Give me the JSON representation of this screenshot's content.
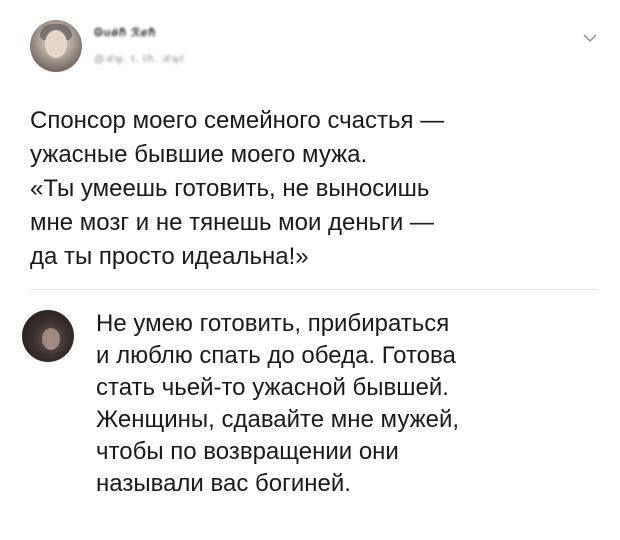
{
  "tweet": {
    "author_name": "Ꙩuǿℏ ℛℯℏ",
    "author_handle": "@ℛꝡ. ℓ. ℓℏ. ℛꝡℓ",
    "text": "Спонсор моего семейного счастья —\nужасные бывшие моего мужа.\n«Ты умеешь готовить, не выносишь\nмне мозг и не тянешь мои деньги —\nда ты просто идеальна!»",
    "menu_icon": "chevron-down-icon"
  },
  "reply": {
    "text": "Не умею готовить, прибираться\nи люблю спать до обеда. Готова\nстать чьей-то ужасной бывшей.\nЖенщины, сдавайте мне мужей,\nчтобы по возвращении они\nназывали вас богиней."
  },
  "colors": {
    "text": "#1a1a1a",
    "divider": "#e4e6e8",
    "secondary": "#888888"
  }
}
